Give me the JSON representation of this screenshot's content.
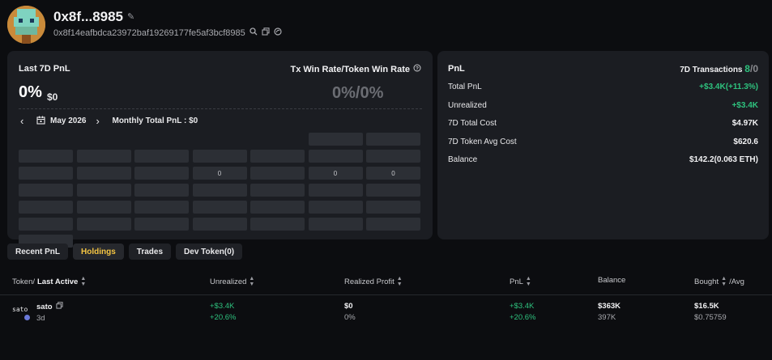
{
  "header": {
    "short_address": "0x8f...8985",
    "full_address": "0x8f14eafbdca23972baf19269177fe5af3bcf8985",
    "edit_icon": "pencil-icon",
    "search_icon": "search-icon",
    "copy_icon": "copy-icon",
    "explorer_icon": "globe-icon"
  },
  "pnl_card": {
    "title": "Last 7D PnL",
    "pnl_percent": "0%",
    "pnl_usd": "$0",
    "win_rate_label": "Tx Win Rate/Token Win Rate",
    "win_rate_value": "0%/0%",
    "month": "May 2026",
    "monthly_total": "Monthly Total PnL :  $0",
    "calendar_cells": [
      "",
      "",
      "",
      "",
      "",
      "",
      "",
      "",
      "",
      "",
      "",
      "",
      "0",
      "",
      "0",
      "0",
      "",
      "",
      "",
      "",
      "",
      "",
      "",
      "",
      "",
      "",
      "",
      "",
      "",
      "",
      "",
      "",
      "",
      "",
      "",
      "",
      "",
      "",
      "",
      "",
      "",
      "",
      "",
      "",
      "",
      "",
      ""
    ]
  },
  "stats": {
    "title": "PnL",
    "tx_label": "7D Transactions",
    "tx_win": "8",
    "tx_sep": "/",
    "tx_loss": "0",
    "rows": [
      {
        "label": "Total PnL",
        "value": "+$3.4K(+11.3%)"
      },
      {
        "label": "Unrealized",
        "value": "+$3.4K"
      },
      {
        "label": "7D Total Cost",
        "value": "$4.97K"
      },
      {
        "label": "7D Token Avg Cost",
        "value": "$620.6"
      },
      {
        "label": "Balance",
        "value": "$142.2(0.063 ETH)"
      }
    ]
  },
  "tabs": [
    "Recent PnL",
    "Holdings",
    "Trades",
    "Dev Token(0)"
  ],
  "active_tab": "Holdings",
  "table": {
    "headers": {
      "token_pre": "Token/",
      "token_bold": "Last Active",
      "unrealized": "Unrealized",
      "realized": "Realized Profit",
      "pnl": "PnL",
      "balance": "Balance",
      "bought": "Bought",
      "avg": "/Avg"
    },
    "rows": [
      {
        "icon_text": "sato",
        "name": "sato",
        "last_active": "3d",
        "unrealized": "+$3.4K",
        "unrealized_pct": "+20.6%",
        "realized": "$0",
        "realized_pct": "0%",
        "pnl": "+$3.4K",
        "pnl_pct": "+20.6%",
        "balance": "$363K",
        "balance_amt": "397K",
        "bought": "$16.5K",
        "avg": "$0.75759"
      }
    ]
  },
  "colors": {
    "green": "#2ec27e",
    "accent_yellow": "#f5c542",
    "card_bg": "#1b1d22",
    "page_bg": "#0c0d10"
  }
}
